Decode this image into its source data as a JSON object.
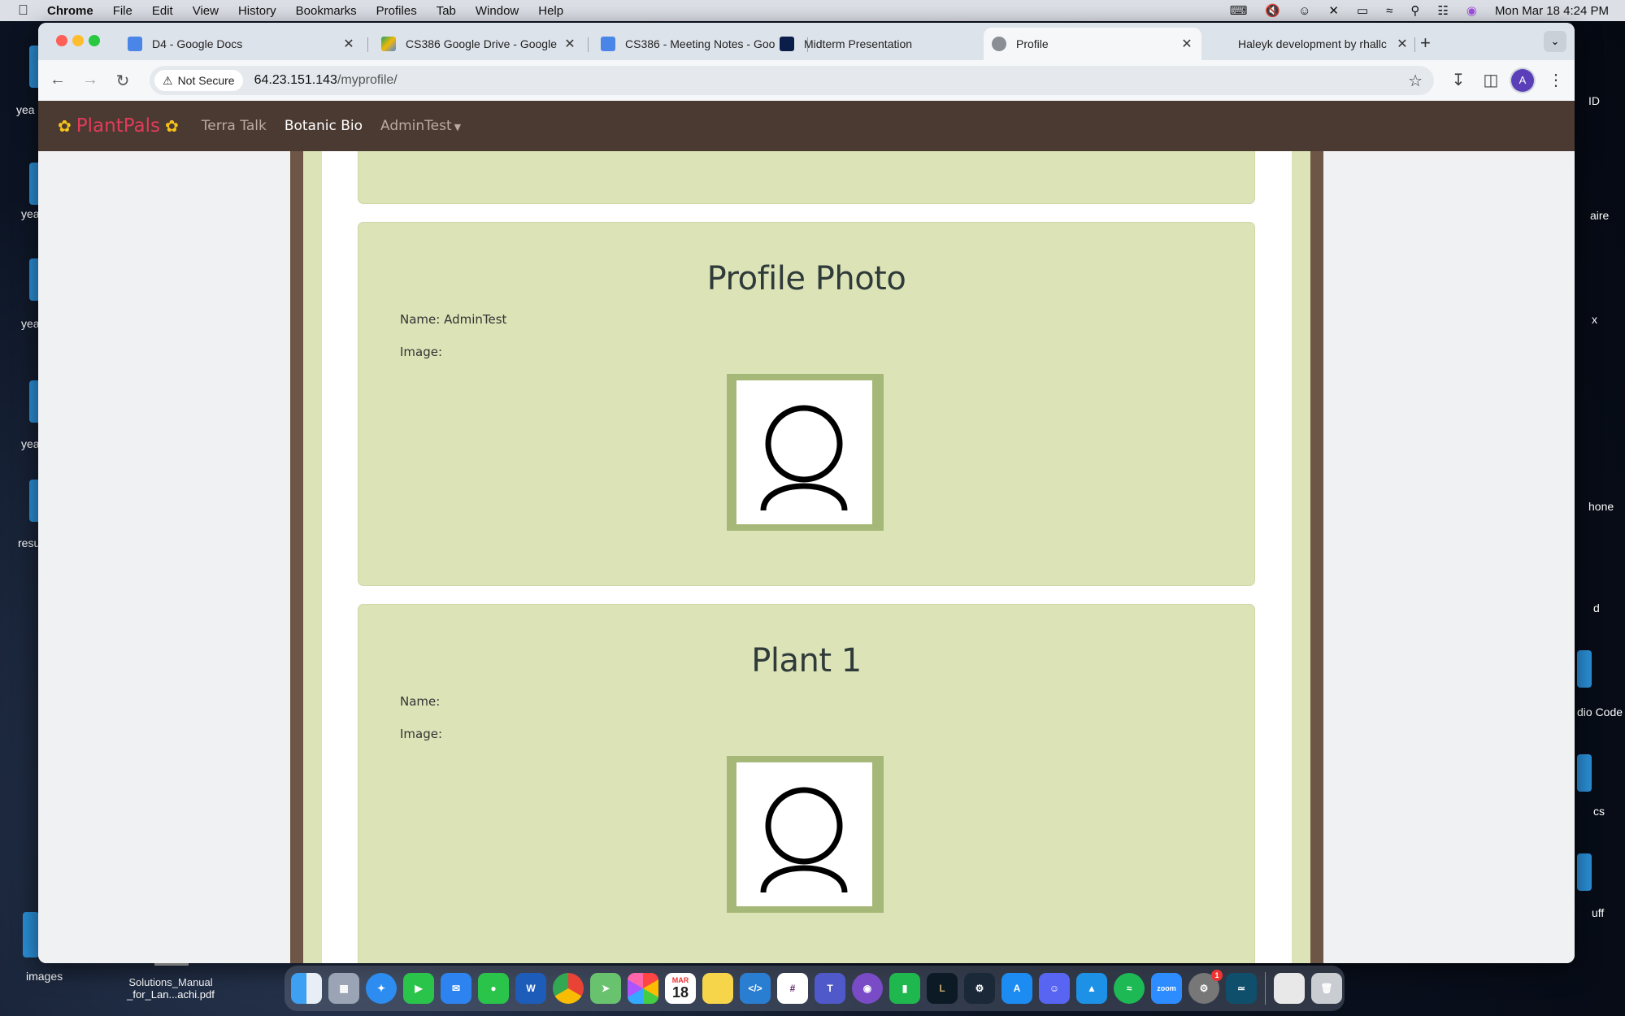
{
  "menubar": {
    "app": "Chrome",
    "items": [
      "File",
      "Edit",
      "View",
      "History",
      "Bookmarks",
      "Profiles",
      "Tab",
      "Window",
      "Help"
    ],
    "clock": "Mon Mar 18  4:24 PM"
  },
  "desktop": {
    "left_labels": [
      "yea",
      "yea",
      "yea",
      "yea",
      "resu"
    ],
    "right_labels": [
      "ID",
      "aire",
      "x",
      "hone",
      "d",
      "dio Code",
      "cs",
      "uff"
    ],
    "bottom_labels": [
      "images",
      "Solutions_Manual\n_for_Lan...achi.pdf"
    ]
  },
  "tabs": [
    {
      "title": "D4 - Google Docs",
      "favicon": "docs-icon",
      "color": "#4a86e8"
    },
    {
      "title": "CS386 Google Drive - Google",
      "favicon": "drive-icon",
      "color": "#f2b705"
    },
    {
      "title": "CS386 - Meeting Notes - Goo",
      "favicon": "docs-icon",
      "color": "#4a86e8"
    },
    {
      "title": "Midterm Presentation",
      "favicon": "nau-icon",
      "color": "#0b1e4b"
    },
    {
      "title": "Profile",
      "favicon": "globe-icon",
      "color": "#8a8f96",
      "active": true
    },
    {
      "title": "Haleyk development by rhallc",
      "favicon": "github-icon",
      "color": "#222"
    }
  ],
  "toolbar": {
    "security": "Not Secure",
    "url_host": "64.23.151.143",
    "url_path": "/myprofile/",
    "avatar_letter": "A"
  },
  "site": {
    "brand": "PlantPals",
    "nav": [
      "Terra Talk",
      "Botanic Bio",
      "AdminTest"
    ],
    "active_nav": "Botanic Bio"
  },
  "cards": [
    {
      "heading": "Profile Photo",
      "name_label": "Name: AdminTest",
      "image_label": "Image:"
    },
    {
      "heading": "Plant 1",
      "name_label": "Name:",
      "image_label": "Image:"
    }
  ],
  "dock": {
    "apps": [
      "Finder",
      "Launchpad",
      "Safari",
      "FaceTime",
      "Mail",
      "Messages",
      "Word",
      "Chrome",
      "Maps",
      "Photos",
      "Calendar",
      "Notes",
      "VS Code",
      "Slack",
      "Teams",
      "GitHub",
      "Numbers",
      "League",
      "Steam",
      "App Store",
      "Discord",
      "Docker",
      "Spotify",
      "Zoom",
      "Settings",
      "MySQL",
      "Preview",
      "Trash"
    ],
    "calendar_month": "MAR",
    "calendar_day": "18",
    "settings_badge": "1"
  }
}
